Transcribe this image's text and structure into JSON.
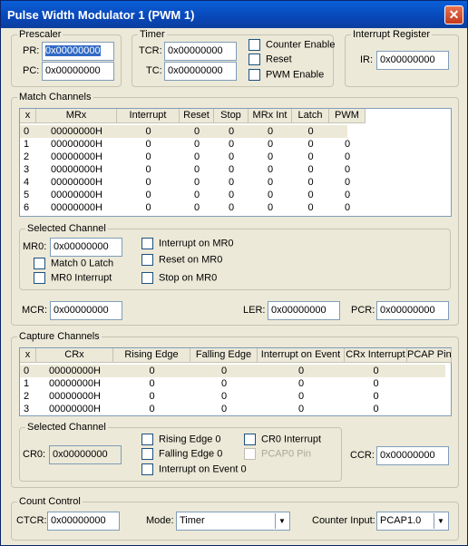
{
  "title": "Pulse Width Modulator 1 (PWM 1)",
  "close_glyph": "✕",
  "prescaler": {
    "legend": "Prescaler",
    "pr_label": "PR:",
    "pr_value": "0x00000000",
    "pc_label": "PC:",
    "pc_value": "0x00000000"
  },
  "timer": {
    "legend": "Timer",
    "tcr_label": "TCR:",
    "tcr_value": "0x00000000",
    "tc_label": "TC:",
    "tc_value": "0x00000000",
    "counter_enable": "Counter Enable",
    "reset": "Reset",
    "pwm_enable": "PWM Enable"
  },
  "interrupt": {
    "legend": "Interrupt Register",
    "ir_label": "IR:",
    "ir_value": "0x00000000"
  },
  "match": {
    "legend": "Match Channels",
    "headers": [
      "x",
      "MRx",
      "Interrupt",
      "Reset",
      "Stop",
      "MRx Int",
      "Latch",
      "PWM"
    ],
    "rows": [
      [
        "0",
        "00000000H",
        "0",
        "0",
        "0",
        "0",
        "0",
        ""
      ],
      [
        "1",
        "00000000H",
        "0",
        "0",
        "0",
        "0",
        "0",
        "0"
      ],
      [
        "2",
        "00000000H",
        "0",
        "0",
        "0",
        "0",
        "0",
        "0"
      ],
      [
        "3",
        "00000000H",
        "0",
        "0",
        "0",
        "0",
        "0",
        "0"
      ],
      [
        "4",
        "00000000H",
        "0",
        "0",
        "0",
        "0",
        "0",
        "0"
      ],
      [
        "5",
        "00000000H",
        "0",
        "0",
        "0",
        "0",
        "0",
        "0"
      ],
      [
        "6",
        "00000000H",
        "0",
        "0",
        "0",
        "0",
        "0",
        "0"
      ]
    ],
    "selected": {
      "legend": "Selected Channel",
      "mr_label": "MR0:",
      "mr_value": "0x00000000",
      "match_latch": "Match 0 Latch",
      "mr_interrupt": "MR0 Interrupt",
      "int_on": "Interrupt on MR0",
      "reset_on": "Reset on MR0",
      "stop_on": "Stop on MR0"
    },
    "mcr_label": "MCR:",
    "mcr_value": "0x00000000",
    "ler_label": "LER:",
    "ler_value": "0x00000000",
    "pcr_label": "PCR:",
    "pcr_value": "0x00000000"
  },
  "capture": {
    "legend": "Capture Channels",
    "headers": [
      "x",
      "CRx",
      "Rising Edge",
      "Falling Edge",
      "Interrupt on Event",
      "CRx Interrupt",
      "PCAP Pin"
    ],
    "rows": [
      [
        "0",
        "00000000H",
        "0",
        "0",
        "0",
        "0",
        ""
      ],
      [
        "1",
        "00000000H",
        "0",
        "0",
        "0",
        "0",
        ""
      ],
      [
        "2",
        "00000000H",
        "0",
        "0",
        "0",
        "0",
        ""
      ],
      [
        "3",
        "00000000H",
        "0",
        "0",
        "0",
        "0",
        ""
      ]
    ],
    "selected": {
      "legend": "Selected Channel",
      "cr_label": "CR0:",
      "cr_value": "0x00000000",
      "rising": "Rising Edge 0",
      "falling": "Falling Edge 0",
      "int_event": "Interrupt on Event 0",
      "cr_interrupt": "CR0 Interrupt",
      "pcap_pin": "PCAP0 Pin"
    },
    "ccr_label": "CCR:",
    "ccr_value": "0x00000000"
  },
  "count": {
    "legend": "Count Control",
    "ctcr_label": "CTCR:",
    "ctcr_value": "0x00000000",
    "mode_label": "Mode:",
    "mode_value": "Timer",
    "input_label": "Counter Input:",
    "input_value": "PCAP1.0",
    "arrow": "▼"
  }
}
